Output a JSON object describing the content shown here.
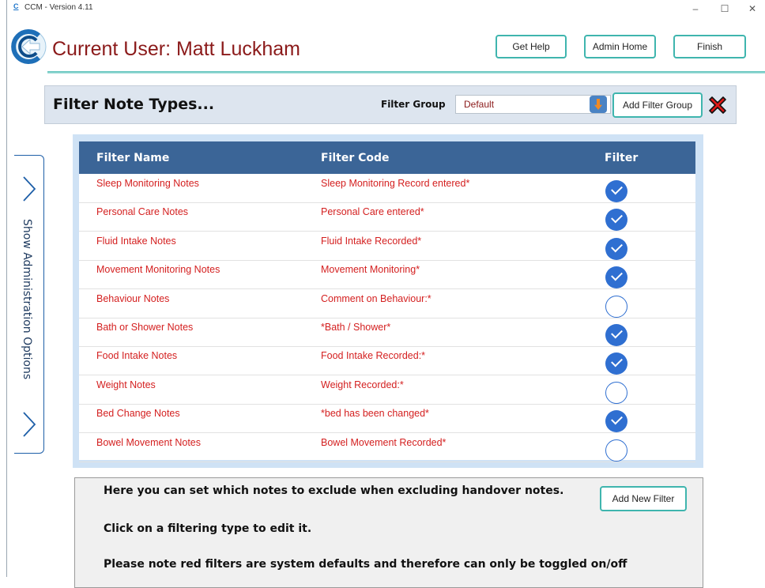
{
  "window": {
    "title": "CCM - Version 4.11",
    "minimize": "–",
    "maximize": "☐",
    "close": "✕"
  },
  "header": {
    "current_user": "Current User: Matt Luckham",
    "buttons": {
      "help": "Get Help",
      "admin_home": "Admin Home",
      "finish": "Finish"
    }
  },
  "filter_panel": {
    "title": "Filter Note Types...",
    "group_label": "Filter Group",
    "group_value": "Default",
    "add_group": "Add Filter Group"
  },
  "side_tab": {
    "label": "Show Administration Options"
  },
  "table": {
    "columns": [
      "Filter Name",
      "Filter Code",
      "Filter"
    ],
    "rows": [
      {
        "name": "Sleep Monitoring Notes",
        "code": "Sleep Monitoring Record entered*",
        "enabled": true
      },
      {
        "name": "Personal Care Notes",
        "code": "Personal Care entered*",
        "enabled": true
      },
      {
        "name": "Fluid Intake Notes",
        "code": "Fluid Intake Recorded*",
        "enabled": true
      },
      {
        "name": "Movement Monitoring Notes",
        "code": "Movement Monitoring*",
        "enabled": true
      },
      {
        "name": "Behaviour Notes",
        "code": "Comment on Behaviour:*",
        "enabled": false
      },
      {
        "name": "Bath or Shower Notes",
        "code": "*Bath / Shower*",
        "enabled": true
      },
      {
        "name": "Food Intake Notes",
        "code": "Food Intake Recorded:*",
        "enabled": true
      },
      {
        "name": "Weight Notes",
        "code": "Weight Recorded:*",
        "enabled": false
      },
      {
        "name": "Bed Change Notes",
        "code": "*bed has been changed*",
        "enabled": true
      },
      {
        "name": "Bowel Movement Notes",
        "code": "Bowel Movement Recorded*",
        "enabled": false
      }
    ]
  },
  "info": {
    "line1": "Here you can set which notes to exclude when excluding handover notes.",
    "line2": "Click on a filtering type to edit it.",
    "line3": "Please note red filters are system defaults and therefore can only be toggled on/off",
    "add_new": "Add New Filter"
  },
  "colors": {
    "accent": "#3fb5ae",
    "header_blue": "#3b6597",
    "filter_text": "#d42020",
    "user_text": "#8b1a1a",
    "check_blue": "#2f6fd1"
  }
}
